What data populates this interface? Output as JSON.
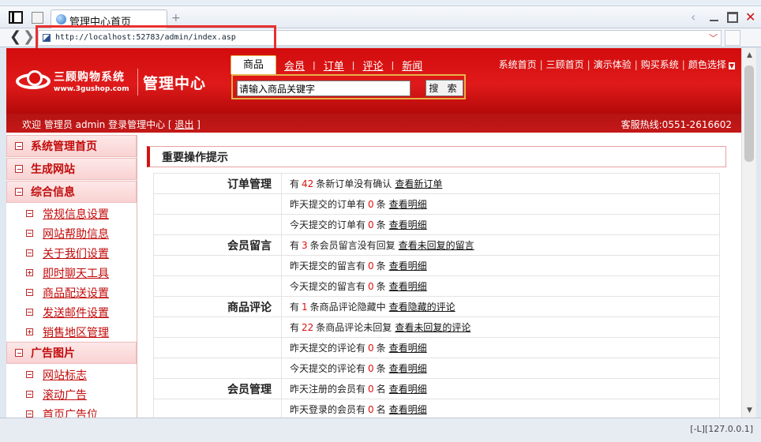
{
  "browser": {
    "tab_title": "管理中心首页",
    "url": "http://localhost:52783/admin/index.asp",
    "status": "[-L][127.0.0.1]"
  },
  "header": {
    "brand_name": "三顾购物系统",
    "brand_url": "www.3gushop.com",
    "admin_title": "管理中心",
    "category_tabs": [
      "商品",
      "会员",
      "订单",
      "评论",
      "新闻"
    ],
    "search_placeholder": "请输入商品关键字",
    "search_button": "搜 索",
    "top_links": [
      "系统首页",
      "三顾首页",
      "演示体验",
      "购买系统",
      "颜色选择"
    ],
    "welcome_prefix": "欢迎 管理员",
    "welcome_user": "admin",
    "welcome_suffix": "登录管理中心 [",
    "logout": "退出",
    "welcome_close": "]",
    "hotline": "客服热线:0551-2616602"
  },
  "sidebar": {
    "sections": [
      {
        "title": "系统管理首页",
        "items": []
      },
      {
        "title": "生成网站",
        "items": []
      },
      {
        "title": "综合信息",
        "items": [
          {
            "label": "常规信息设置",
            "expandable": false
          },
          {
            "label": "网站帮助信息",
            "expandable": false
          },
          {
            "label": "关于我们设置",
            "expandable": false
          },
          {
            "label": "即时聊天工具",
            "expandable": true
          },
          {
            "label": "商品配送设置",
            "expandable": false
          },
          {
            "label": "发送邮件设置",
            "expandable": false
          },
          {
            "label": "销售地区管理",
            "expandable": true
          }
        ]
      },
      {
        "title": "广告图片",
        "items": [
          {
            "label": "网站标志",
            "expandable": false
          },
          {
            "label": "滚动广告",
            "expandable": false
          },
          {
            "label": "首页广告位",
            "expandable": false
          }
        ]
      }
    ]
  },
  "main": {
    "panel_title": "重要操作提示",
    "rows": [
      {
        "category": "订单管理",
        "pre": "有",
        "num": "42",
        "post": "条新订单没有确认",
        "link": "查看新订单"
      },
      {
        "category": "",
        "pre": "昨天提交的订单有",
        "num": "0",
        "post": "条",
        "link": "查看明细"
      },
      {
        "category": "",
        "pre": "今天提交的订单有",
        "num": "0",
        "post": "条",
        "link": "查看明细"
      },
      {
        "category": "会员留言",
        "pre": "有",
        "num": "3",
        "post": "条会员留言没有回复",
        "link": "查看未回复的留言"
      },
      {
        "category": "",
        "pre": "昨天提交的留言有",
        "num": "0",
        "post": "条",
        "link": "查看明细"
      },
      {
        "category": "",
        "pre": "今天提交的留言有",
        "num": "0",
        "post": "条",
        "link": "查看明细"
      },
      {
        "category": "商品评论",
        "pre": "有",
        "num": "1",
        "post": "条商品评论隐藏中",
        "link": "查看隐藏的评论"
      },
      {
        "category": "",
        "pre": "有",
        "num": "22",
        "post": "条商品评论未回复",
        "link": "查看未回复的评论"
      },
      {
        "category": "",
        "pre": "昨天提交的评论有",
        "num": "0",
        "post": "条",
        "link": "查看明细"
      },
      {
        "category": "",
        "pre": "今天提交的评论有",
        "num": "0",
        "post": "条",
        "link": "查看明细"
      },
      {
        "category": "会员管理",
        "pre": "昨天注册的会员有",
        "num": "0",
        "post": "名",
        "link": "查看明细"
      },
      {
        "category": "",
        "pre": "昨天登录的会员有",
        "num": "0",
        "post": "名",
        "link": "查看明细"
      }
    ]
  },
  "colors": {
    "brand_red": "#d20c0c",
    "accent_gold": "#e6b24a",
    "highlight_box": "#e83030"
  }
}
